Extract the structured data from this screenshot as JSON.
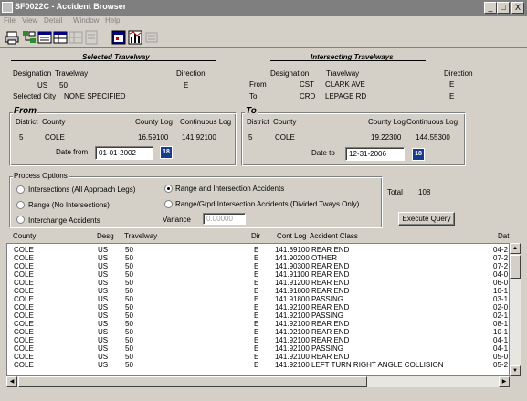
{
  "window": {
    "title": "SF0022C - Accident Browser",
    "minimize": "_",
    "maximize": "□",
    "close": "X"
  },
  "menu": [
    "File",
    "View",
    "Detail",
    "Window",
    "Help"
  ],
  "toolbar": {
    "icons": [
      "print-icon",
      "tree-icon",
      "list-icon",
      "table-icon",
      "table-disabled-icon",
      "report-icon",
      "window-icon",
      "chart-icon",
      "disabled-icon"
    ]
  },
  "selected": {
    "heading": "Selected Travelway",
    "designation_label": "Designation",
    "travelway_label": "Travelway",
    "direction_label": "Direction",
    "designation": "US",
    "travelway": "50",
    "direction": "E",
    "city_label": "Selected City",
    "city": "NONE SPECIFIED"
  },
  "intersecting": {
    "heading": "Intersecting Travelways",
    "designation_label": "Designation",
    "travelway_label": "Travelway",
    "direction_label": "Direction",
    "from_label": "From",
    "from_designation": "CST",
    "from_travelway": "CLARK AVE",
    "from_direction": "E",
    "to_label": "To",
    "to_designation": "CRD",
    "to_travelway": "LEPAGE RD",
    "to_direction": "E"
  },
  "from_box": {
    "title": "From",
    "district_label": "District",
    "county_label": "County",
    "county_log_label": "County Log",
    "continuous_log_label": "Continuous Log",
    "district": "5",
    "county": "COLE",
    "county_log": "16.59100",
    "continuous_log": "141.92100",
    "date_label": "Date from",
    "date": "01-01-2002",
    "cal": "18"
  },
  "to_box": {
    "title": "To",
    "district_label": "District",
    "county_label": "County",
    "county_log_label": "County Log",
    "continuous_log_label": "Continuous Log",
    "district": "5",
    "county": "COLE",
    "county_log": "19.22300",
    "continuous_log": "144.55300",
    "date_label": "Date to",
    "date": "12-31-2006",
    "cal": "18"
  },
  "process": {
    "title": "Process Options",
    "opt1": "Intersections (All Approach Legs)",
    "opt2": "Range (No Intersections)",
    "opt3": "Interchange Accidents",
    "opt4": "Range and Intersection Accidents",
    "opt5": "Range/Grpd Intersection Accidents (Divided Tways Only)",
    "variance_label": "Variance",
    "variance": "0.00000",
    "selected": "opt4"
  },
  "total_label": "Total",
  "total": "108",
  "execute_label": "Execute Query",
  "grid": {
    "columns": [
      "County",
      "Desg",
      "Travelway",
      "Dir",
      "Cont Log",
      "Accident Class",
      "Dat"
    ],
    "rows": [
      [
        "COLE",
        "US",
        "50",
        "E",
        "141.89100",
        "REAR END",
        "04-2"
      ],
      [
        "COLE",
        "US",
        "50",
        "E",
        "141.90200",
        "OTHER",
        "07-2"
      ],
      [
        "COLE",
        "US",
        "50",
        "E",
        "141.90300",
        "REAR END",
        "07-2"
      ],
      [
        "COLE",
        "US",
        "50",
        "E",
        "141.91100",
        "REAR END",
        "04-0"
      ],
      [
        "COLE",
        "US",
        "50",
        "E",
        "141.91200",
        "REAR END",
        "06-0"
      ],
      [
        "COLE",
        "US",
        "50",
        "E",
        "141.91800",
        "REAR END",
        "10-1"
      ],
      [
        "COLE",
        "US",
        "50",
        "E",
        "141.91800",
        "PASSING",
        "03-1"
      ],
      [
        "COLE",
        "US",
        "50",
        "E",
        "141.92100",
        "REAR END",
        "02-0"
      ],
      [
        "COLE",
        "US",
        "50",
        "E",
        "141.92100",
        "PASSING",
        "02-1"
      ],
      [
        "COLE",
        "US",
        "50",
        "E",
        "141.92100",
        "REAR END",
        "08-1"
      ],
      [
        "COLE",
        "US",
        "50",
        "E",
        "141.92100",
        "REAR END",
        "10-1"
      ],
      [
        "COLE",
        "US",
        "50",
        "E",
        "141.92100",
        "REAR END",
        "04-1"
      ],
      [
        "COLE",
        "US",
        "50",
        "E",
        "141.92100",
        "PASSING",
        "04-1"
      ],
      [
        "COLE",
        "US",
        "50",
        "E",
        "141.92100",
        "REAR END",
        "05-0"
      ],
      [
        "COLE",
        "US",
        "50",
        "E",
        "141.92100",
        "LEFT TURN RIGHT ANGLE COLLISION",
        "05-2"
      ]
    ]
  }
}
